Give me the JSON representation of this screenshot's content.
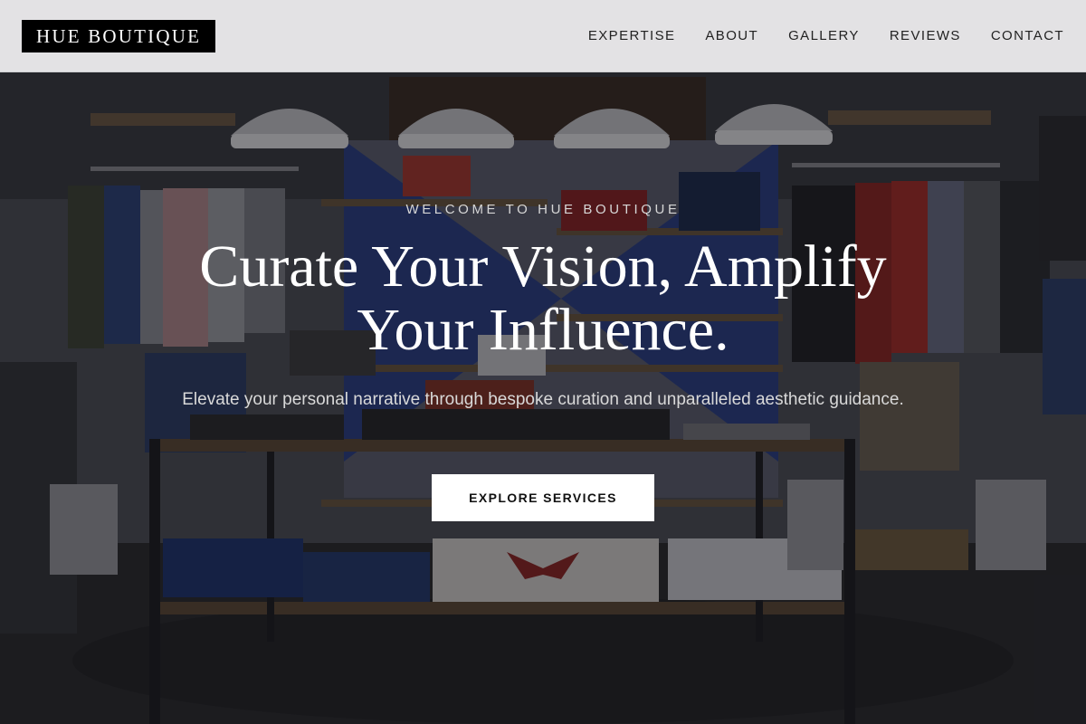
{
  "brand": {
    "logo_text": "HUE BOUTIQUE"
  },
  "nav": {
    "items": [
      {
        "label": "EXPERTISE"
      },
      {
        "label": "ABOUT"
      },
      {
        "label": "GALLERY"
      },
      {
        "label": "REVIEWS"
      },
      {
        "label": "CONTACT"
      }
    ]
  },
  "hero": {
    "eyebrow": "WELCOME TO HUE BOUTIQUE",
    "headline": "Curate Your Vision, Amplify Your Influence.",
    "subtext": "Elevate your personal narrative through bespoke curation and unparalleled aesthetic guidance.",
    "cta_label": "EXPLORE SERVICES",
    "background_image": "boutique-interior-photo"
  },
  "colors": {
    "header_bg": "#e3e2e4",
    "logo_bg": "#000000",
    "hero_overlay": "#0c0c10",
    "cta_bg": "#ffffff",
    "headline": "#ffffff"
  }
}
